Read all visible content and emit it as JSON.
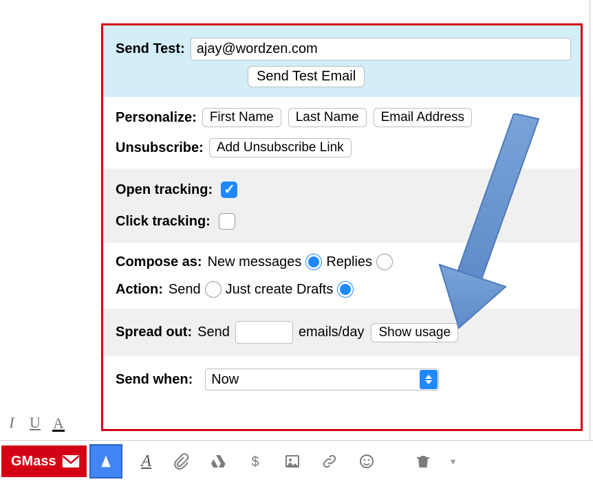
{
  "sendTest": {
    "label": "Send Test:",
    "value": "ajay@wordzen.com",
    "buttonLabel": "Send Test Email"
  },
  "personalize": {
    "label": "Personalize:",
    "buttons": {
      "first": "First Name",
      "last": "Last Name",
      "email": "Email Address"
    }
  },
  "unsubscribe": {
    "label": "Unsubscribe:",
    "button": "Add Unsubscribe Link"
  },
  "tracking": {
    "openLabel": "Open tracking:",
    "openChecked": true,
    "clickLabel": "Click tracking:",
    "clickChecked": false
  },
  "composeAs": {
    "label": "Compose as:",
    "opt1": "New messages",
    "opt2": "Replies",
    "selected": "new"
  },
  "action": {
    "label": "Action:",
    "opt1": "Send",
    "opt2": "Just create Drafts",
    "selected": "drafts"
  },
  "spread": {
    "label": "Spread out:",
    "prefix": "Send",
    "suffix": "emails/day",
    "value": "",
    "showUsage": "Show usage"
  },
  "sendWhen": {
    "label": "Send when:",
    "value": "Now"
  },
  "bottom": {
    "brand": "GMass"
  }
}
